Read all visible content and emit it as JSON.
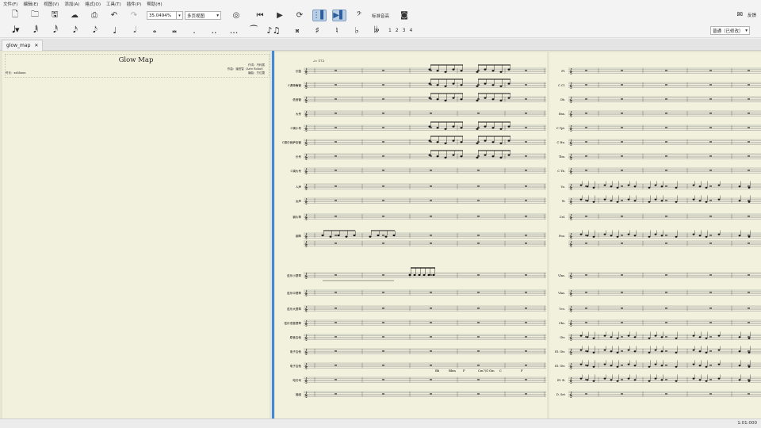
{
  "menu": [
    "文件(F)",
    "编辑(E)",
    "视图(V)",
    "添加(A)",
    "格式(O)",
    "工具(T)",
    "插件(P)",
    "帮助(H)"
  ],
  "toolbar": {
    "icons": [
      "new-score-icon",
      "open-icon",
      "save-icon",
      "upload-cloud-icon",
      "print-icon",
      "undo-icon",
      "redo-icon"
    ],
    "zoom_value": "35.0494%",
    "view_mode": "多页视图",
    "playback": [
      "rewind-icon",
      "play-icon",
      "loop-icon"
    ],
    "pitch_label": "标准音高",
    "feedback_label": "反馈"
  },
  "note_input": {
    "durations": [
      "𝅘𝅥𝅱",
      "𝅘𝅥𝅰",
      "𝅘𝅥𝅯",
      "𝅘𝅥𝅮",
      "♩",
      "𝅗𝅥",
      "𝅝",
      "𝅜",
      ".",
      "..",
      "..."
    ],
    "accidentals": [
      "𝄪",
      "♯",
      "♮",
      "♭",
      "𝄫"
    ],
    "voices": [
      "1",
      "2",
      "3",
      "4"
    ],
    "layer": "普通（已修改）"
  },
  "tab": {
    "label": "glow_map"
  },
  "score": {
    "title": "Glow Map",
    "lyricist": "作词：不科属",
    "composer": "作曲：潘田智（Arte Rohat）",
    "arranger": "编曲：方位置",
    "meter_text": "时长：xxhhmm",
    "page1_staves": [
      "长笛",
      "C调单簧管",
      "低音管",
      "大号",
      "C调小号",
      "C调中音萨克管",
      "长号",
      "C调大号",
      "人声",
      "女声",
      "钢片琴",
      "钢琴",
      "弦乐小提琴",
      "弦乐中提琴",
      "弦乐大提琴",
      "弦乐低音提琴",
      "原音吉他",
      "电子吉他",
      "电子吉他",
      "电贝司",
      "鼓组"
    ],
    "page3_staves": [
      "Fl.",
      "C Cl.",
      "Ob.",
      "Bsn.",
      "C Tpt.",
      "C Hn.",
      "Tbn.",
      "C Tb.",
      "Vo.",
      "W.",
      "Cel.",
      "Pno.",
      "Vlns.",
      "Vlas.",
      "Vcs.",
      "Cbs.",
      "Gtr.",
      "El. Gtr.",
      "El. Gtr.",
      "El. B.",
      "D. Set"
    ],
    "chord_symbols": [
      "Bb",
      "Bbm",
      "F",
      "Cm7/G",
      "Gm",
      "C",
      "F",
      "Bbm",
      "C"
    ]
  },
  "status": {
    "time": "1:01:000"
  },
  "colors": {
    "paper": "#f2f1de",
    "cursor": "#3f8ad8",
    "canvas": "#e6e5d4"
  }
}
